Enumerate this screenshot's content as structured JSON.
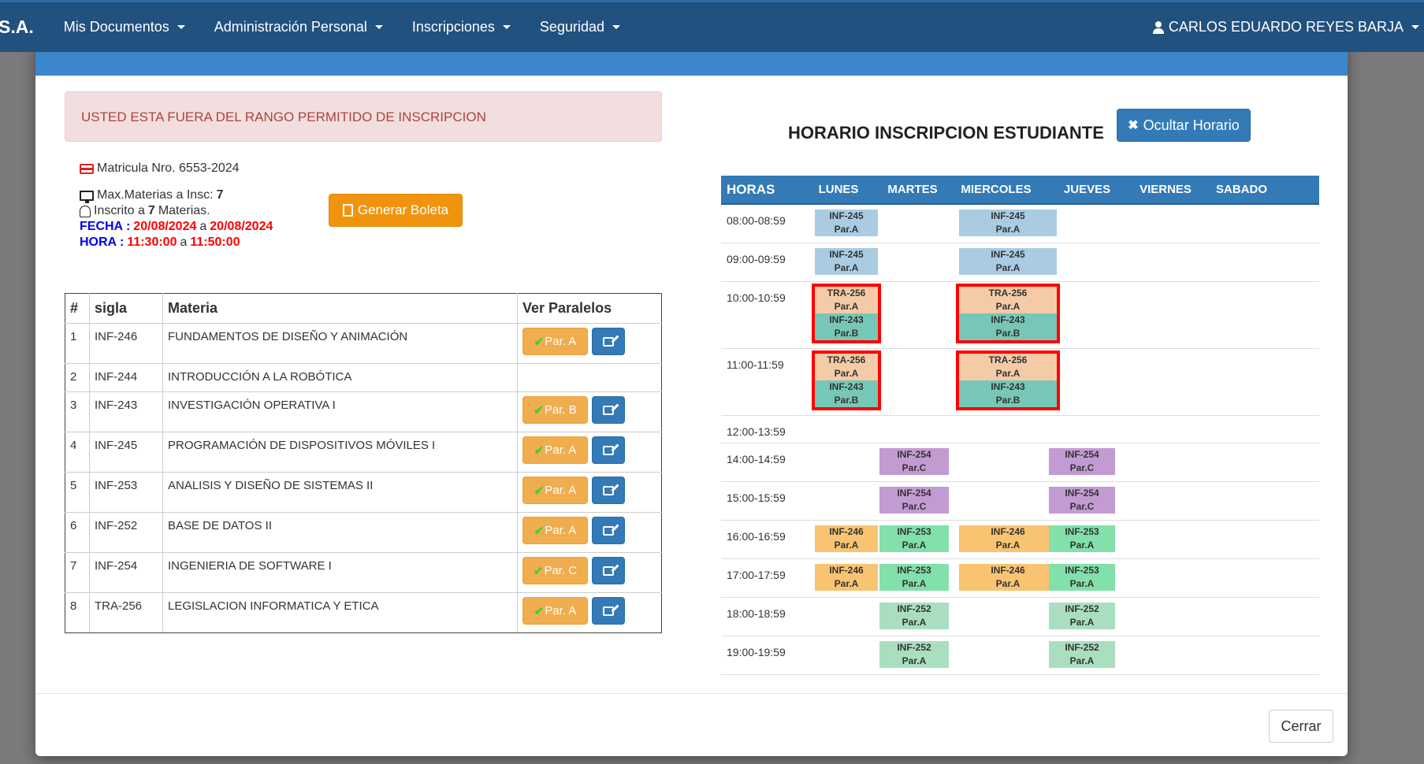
{
  "navbar": {
    "brand": "S.A.",
    "menu": [
      "Mis Documentos",
      "Administración Personal",
      "Inscripciones",
      "Seguridad"
    ],
    "user": "CARLOS EDUARDO REYES BARJA"
  },
  "alert": "USTED ESTA FUERA DEL RANGO PERMITIDO DE INSCRIPCION",
  "info": {
    "matricula": "Matricula Nro. 6553-2024",
    "max_prefix": "Max.Materias a Insc:",
    "max_value": "7",
    "inscrito_prefix": "Inscrito a",
    "inscrito_value": "7",
    "inscrito_suffix": "Materias.",
    "fecha_label": "FECHA :",
    "fecha_from": "20/08/2024",
    "fecha_sep": "a",
    "fecha_to": "20/08/2024",
    "hora_label": "HORA :",
    "hora_from": "11:30:00",
    "hora_sep": "a",
    "hora_to": "11:50:00"
  },
  "boleta_button": "Generar Boleta",
  "table": {
    "headers": [
      "#",
      "sigla",
      "Materia",
      "Ver Paralelos"
    ],
    "rows": [
      {
        "n": "1",
        "sigla": "INF-246",
        "materia": "FUNDAMENTOS DE DISEÑO Y ANIMACIÓN",
        "par": "Par. A"
      },
      {
        "n": "2",
        "sigla": "INF-244",
        "materia": "INTRODUCCIÓN A LA ROBÓTICA",
        "par": ""
      },
      {
        "n": "3",
        "sigla": "INF-243",
        "materia": "INVESTIGACIÓN OPERATIVA I",
        "par": "Par. B"
      },
      {
        "n": "4",
        "sigla": "INF-245",
        "materia": "PROGRAMACIÓN DE DISPOSITIVOS MÓVILES I",
        "par": "Par. A"
      },
      {
        "n": "5",
        "sigla": "INF-253",
        "materia": "ANALISIS Y DISEÑO DE SISTEMAS II",
        "par": "Par. A"
      },
      {
        "n": "6",
        "sigla": "INF-252",
        "materia": "BASE DE DATOS II",
        "par": "Par. A"
      },
      {
        "n": "7",
        "sigla": "INF-254",
        "materia": "INGENIERIA DE SOFTWARE I",
        "par": "Par. C"
      },
      {
        "n": "8",
        "sigla": "TRA-256",
        "materia": "LEGISLACION INFORMATICA Y ETICA",
        "par": "Par. A"
      }
    ]
  },
  "schedule": {
    "title": "HORARIO INSCRIPCION ESTUDIANTE",
    "hide_button": "Ocultar Horario",
    "horas_label": "HORAS",
    "days": [
      "LUNES",
      "MARTES",
      "MIERCOLES",
      "JUEVES",
      "VIERNES",
      "SABADO"
    ],
    "slots": [
      {
        "time": "08:00-08:59",
        "cells": [
          {
            "day": 0,
            "code": "INF-245",
            "par": "Par.A",
            "color": "#a9cce3"
          },
          {
            "day": 2,
            "code": "INF-245",
            "par": "Par.A",
            "color": "#a9cce3"
          }
        ]
      },
      {
        "time": "09:00-09:59",
        "cells": [
          {
            "day": 0,
            "code": "INF-245",
            "par": "Par.A",
            "color": "#a9cce3"
          },
          {
            "day": 2,
            "code": "INF-245",
            "par": "Par.A",
            "color": "#a9cce3"
          }
        ]
      },
      {
        "time": "10:00-10:59",
        "conflict": true,
        "cells": [
          {
            "day": 0,
            "stack": [
              {
                "code": "TRA-256",
                "par": "Par.A",
                "color": "#f5cba7"
              },
              {
                "code": "INF-243",
                "par": "Par.B",
                "color": "#76c7b7"
              }
            ]
          },
          {
            "day": 2,
            "stack": [
              {
                "code": "TRA-256",
                "par": "Par.A",
                "color": "#f5cba7"
              },
              {
                "code": "INF-243",
                "par": "Par.B",
                "color": "#76c7b7"
              }
            ]
          }
        ]
      },
      {
        "time": "11:00-11:59",
        "conflict": true,
        "cells": [
          {
            "day": 0,
            "stack": [
              {
                "code": "TRA-256",
                "par": "Par.A",
                "color": "#f5cba7"
              },
              {
                "code": "INF-243",
                "par": "Par.B",
                "color": "#76c7b7"
              }
            ]
          },
          {
            "day": 2,
            "stack": [
              {
                "code": "TRA-256",
                "par": "Par.A",
                "color": "#f5cba7"
              },
              {
                "code": "INF-243",
                "par": "Par.B",
                "color": "#76c7b7"
              }
            ]
          }
        ]
      },
      {
        "time": "12:00-13:59",
        "cells": []
      },
      {
        "time": "14:00-14:59",
        "cells": [
          {
            "day": 1,
            "code": "INF-254",
            "par": "Par.C",
            "color": "#c39bd3"
          },
          {
            "day": 3,
            "code": "INF-254",
            "par": "Par.C",
            "color": "#c39bd3"
          }
        ]
      },
      {
        "time": "15:00-15:59",
        "cells": [
          {
            "day": 1,
            "code": "INF-254",
            "par": "Par.C",
            "color": "#c39bd3"
          },
          {
            "day": 3,
            "code": "INF-254",
            "par": "Par.C",
            "color": "#c39bd3"
          }
        ]
      },
      {
        "time": "16:00-16:59",
        "cells": [
          {
            "day": 0,
            "code": "INF-246",
            "par": "Par.A",
            "color": "#f8c471"
          },
          {
            "day": 1,
            "code": "INF-253",
            "par": "Par.A",
            "color": "#82e0aa"
          },
          {
            "day": 2,
            "code": "INF-246",
            "par": "Par.A",
            "color": "#f8c471"
          },
          {
            "day": 3,
            "code": "INF-253",
            "par": "Par.A",
            "color": "#82e0aa"
          }
        ]
      },
      {
        "time": "17:00-17:59",
        "cells": [
          {
            "day": 0,
            "code": "INF-246",
            "par": "Par.A",
            "color": "#f8c471"
          },
          {
            "day": 1,
            "code": "INF-253",
            "par": "Par.A",
            "color": "#82e0aa"
          },
          {
            "day": 2,
            "code": "INF-246",
            "par": "Par.A",
            "color": "#f8c471"
          },
          {
            "day": 3,
            "code": "INF-253",
            "par": "Par.A",
            "color": "#82e0aa"
          }
        ]
      },
      {
        "time": "18:00-18:59",
        "cells": [
          {
            "day": 1,
            "code": "INF-252",
            "par": "Par.A",
            "color": "#a9dfbf"
          },
          {
            "day": 3,
            "code": "INF-252",
            "par": "Par.A",
            "color": "#a9dfbf"
          }
        ]
      },
      {
        "time": "19:00-19:59",
        "cells": [
          {
            "day": 1,
            "code": "INF-252",
            "par": "Par.A",
            "color": "#a9dfbf"
          },
          {
            "day": 3,
            "code": "INF-252",
            "par": "Par.A",
            "color": "#a9dfbf"
          }
        ]
      }
    ]
  },
  "close_button": "Cerrar"
}
